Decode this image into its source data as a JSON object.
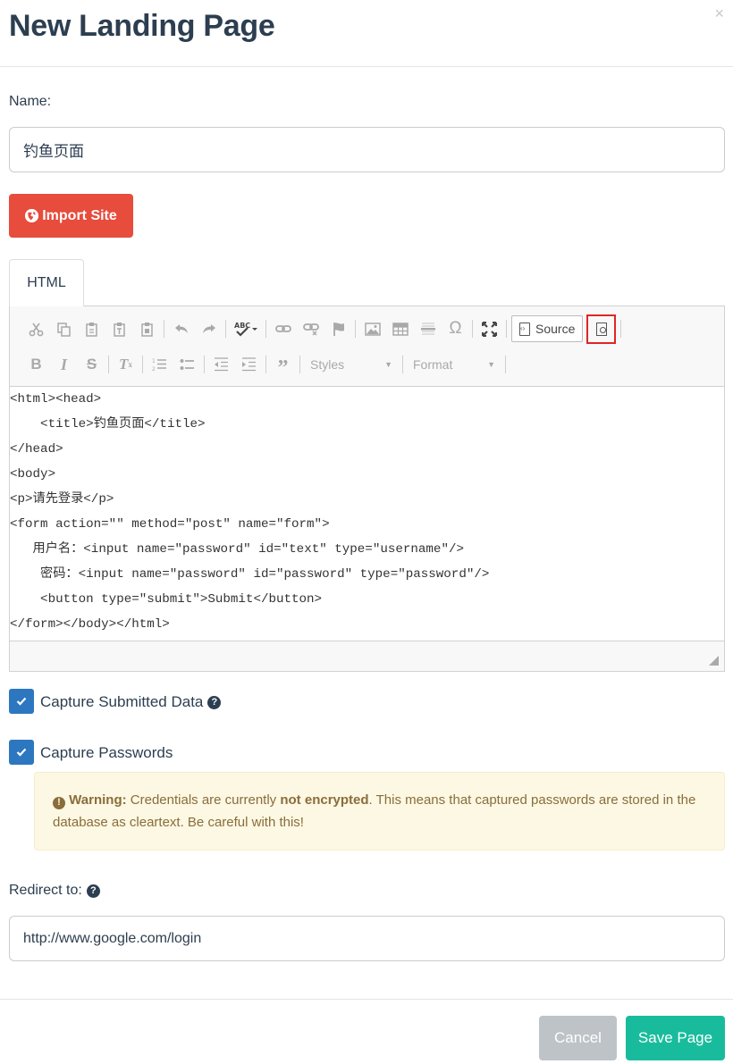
{
  "modal": {
    "title": "New Landing Page",
    "close_glyph": "×"
  },
  "name_field": {
    "label": "Name:",
    "value": "钓鱼页面"
  },
  "import_button": {
    "label": "Import Site",
    "icon": "globe-icon"
  },
  "editor": {
    "tab_label": "HTML",
    "toolbar": {
      "row1": [
        "cut-icon",
        "copy-icon",
        "paste-icon",
        "paste-text-icon",
        "paste-word-icon",
        "undo-icon",
        "redo-icon",
        "spellcheck-icon",
        "link-icon",
        "unlink-icon",
        "anchor-icon",
        "image-icon",
        "table-icon",
        "horizontal-rule-icon",
        "special-char-icon",
        "maximize-icon"
      ],
      "source_label": "Source",
      "preview_icon": "preview-icon",
      "row2": [
        "bold-icon",
        "italic-icon",
        "strike-icon",
        "remove-format-icon",
        "numbered-list-icon",
        "bulleted-list-icon",
        "outdent-icon",
        "indent-icon",
        "blockquote-icon"
      ],
      "styles_label": "Styles",
      "format_label": "Format"
    },
    "source_lines": [
      "<html><head>",
      "    <title>钓鱼页面</title>",
      "</head>",
      "<body>",
      "<p>请先登录</p>",
      "<form action=\"\" method=\"post\" name=\"form\">",
      "   用户名：<input name=\"password\" id=\"text\" type=\"username\"/>",
      "    密码：<input name=\"password\" id=\"password\" type=\"password\"/>",
      "    <button type=\"submit\">Submit</button>",
      "</form></body></html>"
    ]
  },
  "capture_submitted": {
    "label": "Capture Submitted Data",
    "checked": true
  },
  "capture_passwords": {
    "label": "Capture Passwords",
    "checked": true
  },
  "warning": {
    "prefix": "Warning:",
    "text_1": " Credentials are currently ",
    "emphasis": "not encrypted",
    "text_2": ". This means that captured passwords are stored in the database as cleartext. Be careful with this!"
  },
  "redirect": {
    "label": "Redirect to:",
    "value": "http://www.google.com/login"
  },
  "footer": {
    "cancel_label": "Cancel",
    "save_label": "Save Page"
  },
  "colors": {
    "import": "#e74c3c",
    "save": "#18bc9c",
    "cancel": "#bdc3c7",
    "checkbox": "#2c77c0",
    "warning_bg": "#fcf8e3",
    "highlight": "#e02525"
  }
}
